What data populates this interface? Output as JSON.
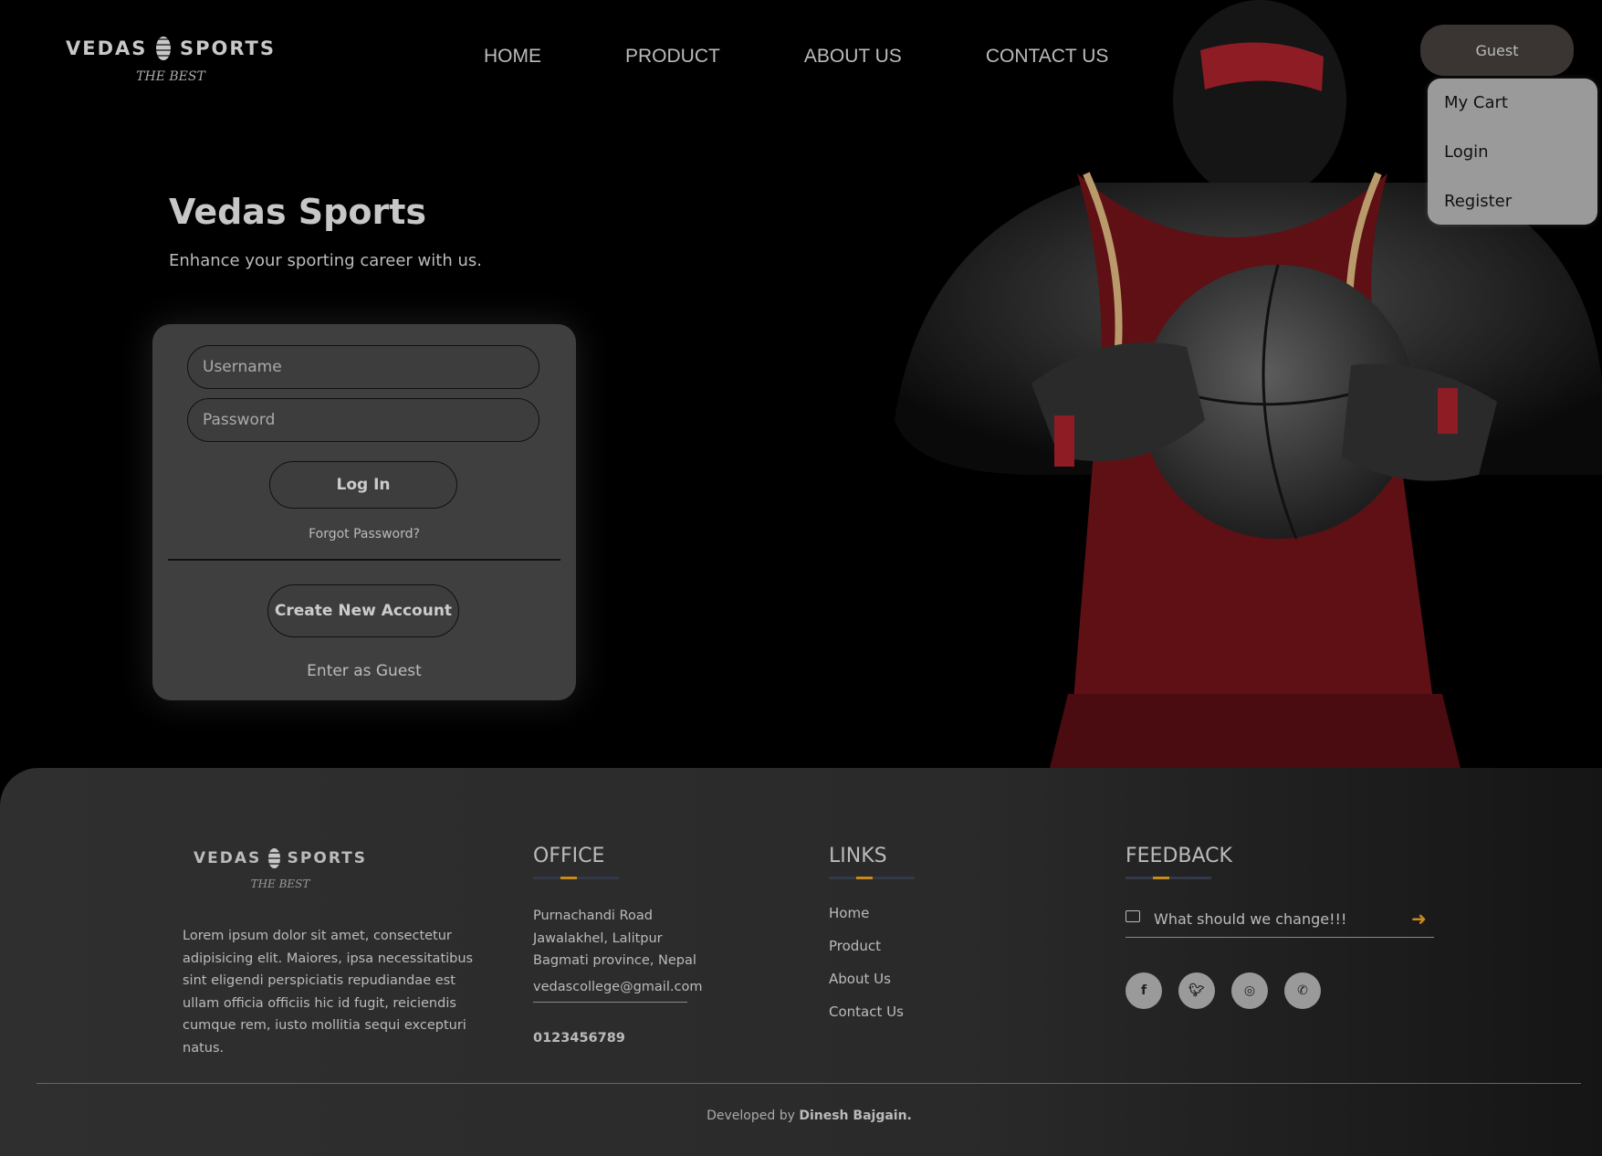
{
  "brand": {
    "name_left": "VEDAS",
    "name_right": "SPORTS",
    "tagline": "THE BEST"
  },
  "nav": {
    "items": [
      "HOME",
      "PRODUCT",
      "ABOUT US",
      "CONTACT US"
    ]
  },
  "account": {
    "guest_label": "Guest",
    "menu": [
      "My Cart",
      "Login",
      "Register"
    ]
  },
  "hero": {
    "title": "Vedas Sports",
    "subtitle": "Enhance your sporting career with us."
  },
  "login": {
    "username_placeholder": "Username",
    "password_placeholder": "Password",
    "login_label": "Log In",
    "forgot_label": "Forgot Password?",
    "create_label": "Create New Account",
    "guest_label": "Enter as Guest"
  },
  "footer": {
    "about_text": "Lorem ipsum dolor sit amet, consectetur adipisicing elit. Maiores, ipsa necessitatibus sint eligendi perspiciatis repudiandae est ullam officia officiis hic id fugit, reiciendis cumque rem, iusto mollitia sequi excepturi natus.",
    "office": {
      "heading": "OFFICE",
      "line1": "Purnachandi Road",
      "line2": "Jawalakhel, Lalitpur",
      "line3": "Bagmati province, Nepal",
      "email": "vedascollege@gmail.com",
      "phone": "0123456789"
    },
    "links": {
      "heading": "LINKS",
      "items": [
        "Home",
        "Product",
        "About Us",
        "Contact Us"
      ]
    },
    "feedback": {
      "heading": "FEEDBACK",
      "placeholder": "What should we change!!!",
      "socials": [
        "facebook-icon",
        "twitter-icon",
        "instagram-icon",
        "whatsapp-icon"
      ]
    },
    "credit_prefix": "Developed by",
    "credit_name": "Dinesh Bajgain."
  },
  "colors": {
    "accent": "#c98a1b",
    "headband": "#8e1c24",
    "jersey": "#7a1418"
  }
}
